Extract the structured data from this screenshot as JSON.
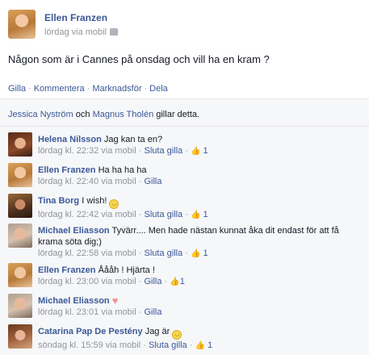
{
  "post": {
    "author": "Ellen Franzen",
    "meta": "lördag via mobil",
    "text": "Någon som är i Cannes på onsdag och vill ha en kram ?"
  },
  "actions": {
    "like": "Gilla",
    "comment": "Kommentera",
    "promote": "Marknadsför",
    "share": "Dela",
    "separator": "·"
  },
  "likes_text": {
    "name1": "Jessica Nyström",
    "and": "och",
    "name2": "Magnus Tholén",
    "rest": "gillar detta."
  },
  "comments": [
    {
      "name": "Helena Nilsson",
      "text": "Jag kan ta en?",
      "time": "lördag kl. 22:32 via mobil",
      "action": "Sluta gilla",
      "likes": "1"
    },
    {
      "name": "Ellen Franzen",
      "text": "Ha ha ha ha",
      "time": "lördag kl. 22:40 via mobil",
      "action": "Gilla",
      "likes": ""
    },
    {
      "name": "Tina Borg",
      "text": "I wish!",
      "time": "lördag kl. 22:42 via mobil",
      "action": "Sluta gilla",
      "likes": "1"
    },
    {
      "name": "Michael Eliasson",
      "text": "Tyvärr.... Men hade nästan kunnat åka dit endast för att få",
      "text2": "krama söta dig;)",
      "time": "lördag kl. 22:58 via mobil",
      "action": "Sluta gilla",
      "likes": "1"
    },
    {
      "name": "Ellen Franzen",
      "text": "Åååh ! Hjärta !",
      "time": "lördag kl. 23:00 via mobil",
      "action": "Gilla",
      "likes": "1"
    },
    {
      "name": "Michael Eliasson",
      "text": "",
      "time": "lördag kl. 23:01 via mobil",
      "action": "Gilla",
      "likes": ""
    },
    {
      "name": "Catarina Pap De Pestény",
      "text": "Jag är",
      "time": "söndag kl. 15:59 via mobil",
      "action": "Sluta gilla",
      "likes": "1"
    }
  ],
  "meta_separator": "·",
  "icons": {
    "like": "thumbs-up-icon",
    "smile": "smile-emoji-icon",
    "heart": "heart-emoji-icon",
    "audience": "audience-icon"
  },
  "colors": {
    "link": "#3b5998",
    "meta": "#90949c",
    "ufi_bg": "#f6f7f9"
  }
}
